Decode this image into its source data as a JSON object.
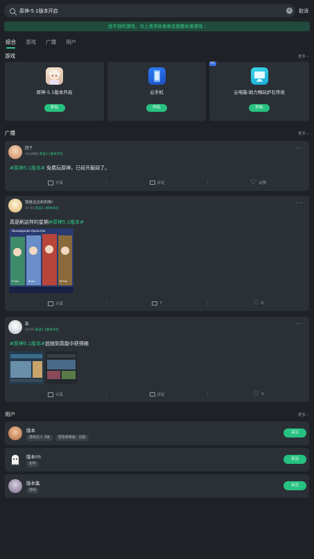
{
  "search": {
    "query": "原神-5.1版本开启",
    "cancel_label": "取消"
  },
  "banner": {
    "text": "找不到的游戏，马上请求收录意见我要收录游戏 ›"
  },
  "tabs": [
    {
      "label": "综合",
      "active": true
    },
    {
      "label": "游戏",
      "active": false
    },
    {
      "label": "广播",
      "active": false
    },
    {
      "label": "用户",
      "active": false
    }
  ],
  "games_section": {
    "title": "游戏",
    "more": "更多 ›"
  },
  "games": [
    {
      "name": "原神-5.1版本开启",
      "button": "秒玩",
      "icon": "genshin-character-icon"
    },
    {
      "name": "云手机",
      "button": "秒玩",
      "icon": "cloud-phone-icon"
    },
    {
      "name": "云电脑-助力畅玩炉石传说",
      "button": "秒玩",
      "icon": "cloud-pc-icon",
      "tag": "PC"
    }
  ],
  "broadcast_section": {
    "title": "广播",
    "more": "更多 ›"
  },
  "posts": [
    {
      "author": "团子",
      "meta_time": "14分钟前",
      "meta_tag": "来自5.1版本开启",
      "text_tag": "#原神5.1版本#",
      "text_body": " 免费玩原神，已经开服阅了。",
      "share": "分享",
      "comment": "评论",
      "like": "点赞"
    },
    {
      "author": "我是达达利的狗！",
      "meta_time": "10-09",
      "meta_tag": "来自5.1版本开启",
      "text_body": "真是刷这样的星期",
      "text_tag": "#原神5.1版本#",
      "image_caption": "Нахождение Архонтов",
      "image_labels": [
        "Огонь",
        "Вода",
        "Ветер"
      ],
      "share": "分享",
      "comment": "7",
      "like": "6"
    },
    {
      "author": "蛋",
      "meta_time": "10-09",
      "meta_tag": "来自5.1版本开启",
      "text_tag": "#原神5.1版本#",
      "text_body": "追随到真能中获得箱",
      "share": "分享",
      "comment": "评论",
      "like": "3"
    }
  ],
  "users_section": {
    "title": "用户",
    "more": "更多 ›"
  },
  "users": [
    {
      "name": "版本",
      "badges": [
        "游戏达人 3级",
        "冒险家等级：创造"
      ],
      "button": "关注"
    },
    {
      "name": "版本05",
      "badges": [
        "初学"
      ],
      "button": "关注"
    },
    {
      "name": "版本集",
      "badges": [
        "游戏"
      ],
      "button": "关注"
    }
  ],
  "colors": {
    "accent": "#27c282",
    "background": "#1e2226",
    "card": "#2a3036"
  }
}
